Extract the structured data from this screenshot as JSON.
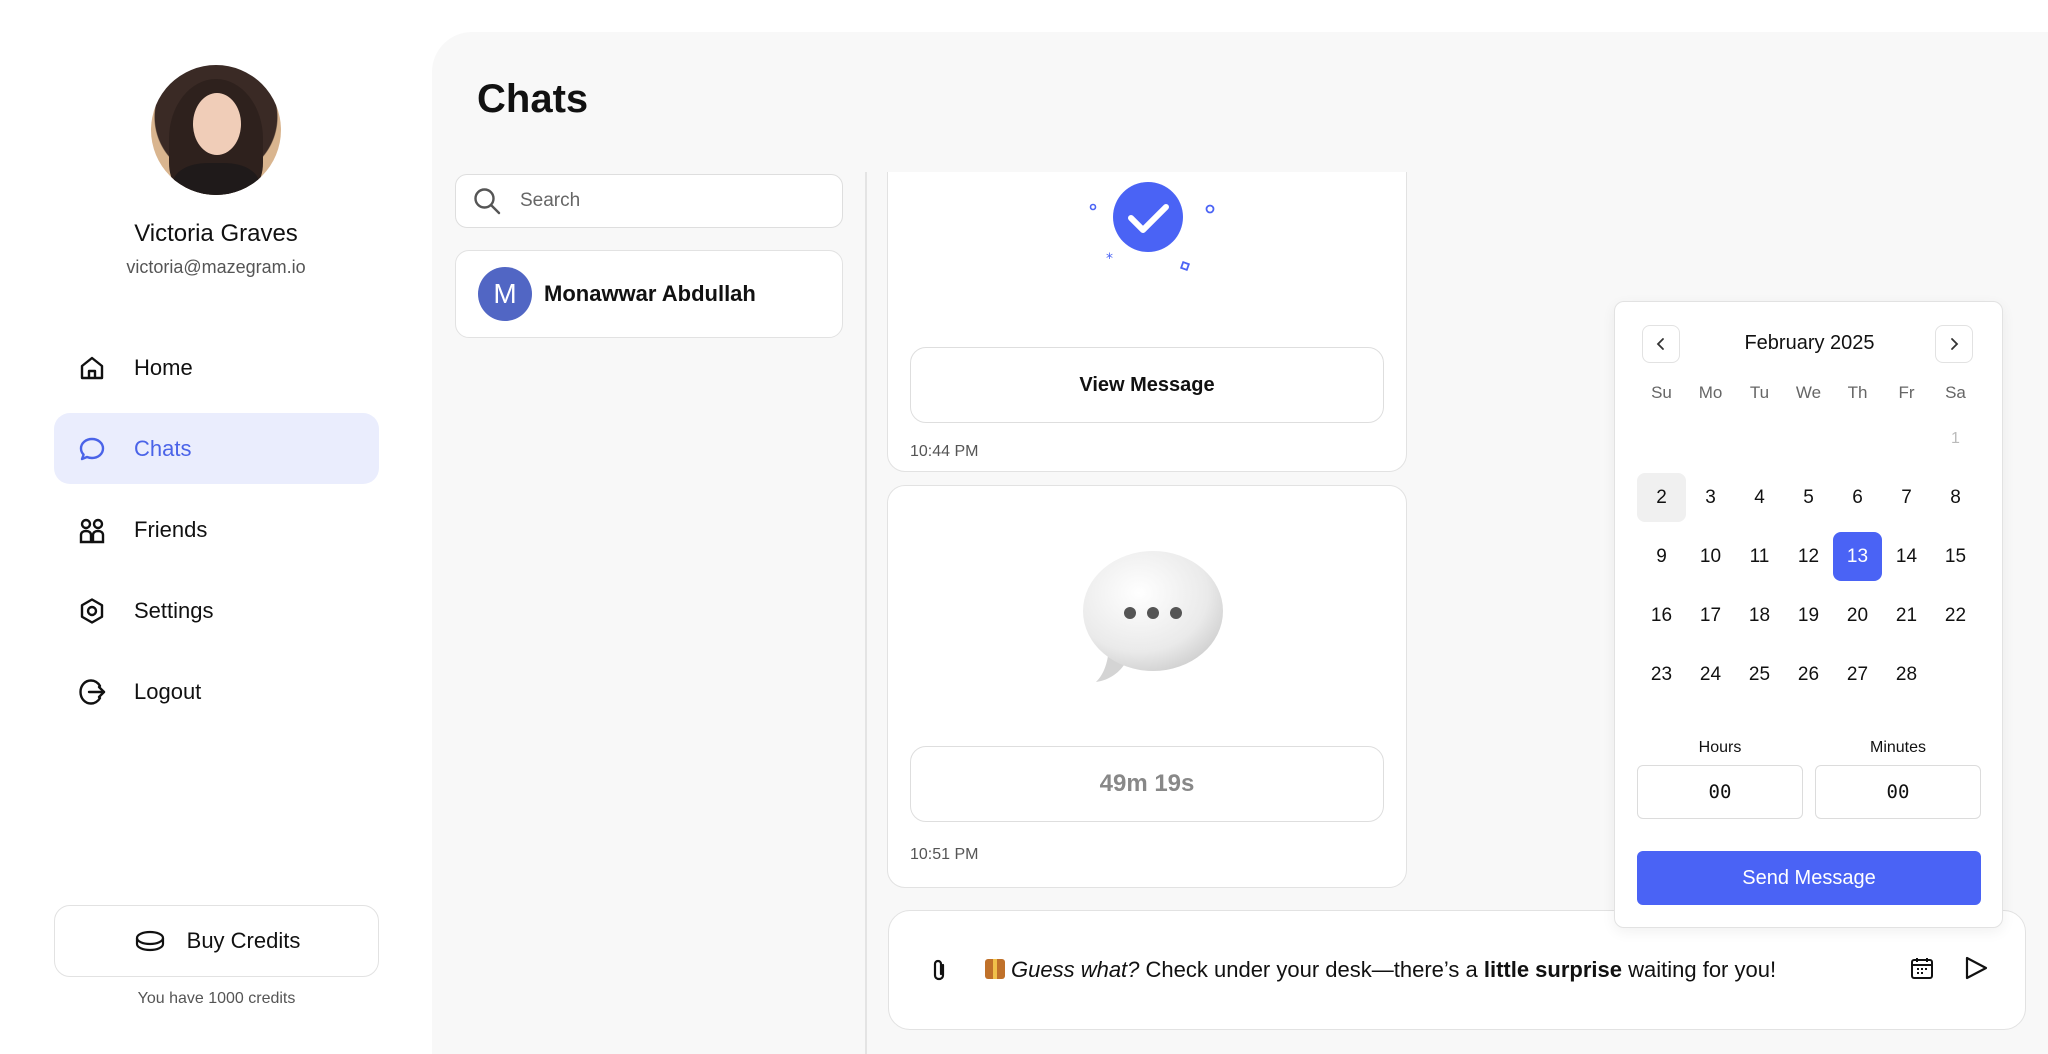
{
  "profile": {
    "name": "Victoria Graves",
    "email": "victoria@mazegram.io"
  },
  "nav": {
    "items": [
      {
        "label": "Home",
        "icon": "home-icon"
      },
      {
        "label": "Chats",
        "icon": "chat-bubble-icon",
        "active": true
      },
      {
        "label": "Friends",
        "icon": "friends-icon"
      },
      {
        "label": "Settings",
        "icon": "settings-icon"
      },
      {
        "label": "Logout",
        "icon": "logout-icon"
      }
    ]
  },
  "credits": {
    "buy_label": "Buy Credits",
    "balance_text": "You have 1000 credits"
  },
  "page": {
    "title": "Chats"
  },
  "search": {
    "placeholder": "Search",
    "value": ""
  },
  "contacts": [
    {
      "initial": "M",
      "name": "Monawwar Abdullah"
    }
  ],
  "messages": [
    {
      "button_label": "View Message",
      "time": "10:44 PM",
      "icon": "check-circle-icon"
    },
    {
      "button_label": "49m 19s",
      "time": "10:51 PM",
      "icon": "speech-bubble-icon"
    }
  ],
  "composer": {
    "emoji": "gift-icon",
    "text_italic": "Guess what?",
    "text_before_bold": " Check under your desk—there’s a ",
    "text_bold": "little surprise",
    "text_after_bold": " waiting for you!"
  },
  "date_picker": {
    "month_label": "February 2025",
    "weekdays": [
      "Su",
      "Mo",
      "Tu",
      "We",
      "Th",
      "Fr",
      "Sa"
    ],
    "weeks": [
      [
        "",
        "",
        "",
        "",
        "",
        "",
        "1"
      ],
      [
        "2",
        "3",
        "4",
        "5",
        "6",
        "7",
        "8"
      ],
      [
        "9",
        "10",
        "11",
        "12",
        "13",
        "14",
        "15"
      ],
      [
        "16",
        "17",
        "18",
        "19",
        "20",
        "21",
        "22"
      ],
      [
        "23",
        "24",
        "25",
        "26",
        "27",
        "28",
        ""
      ]
    ],
    "today": "2",
    "selected": "13",
    "hours_label": "Hours",
    "minutes_label": "Minutes",
    "hours_value": "00",
    "minutes_value": "00",
    "send_label": "Send Message"
  },
  "colors": {
    "accent": "#4a63f5",
    "nav_active_bg": "#eaedfd",
    "contact_avatar": "#5166c4"
  }
}
